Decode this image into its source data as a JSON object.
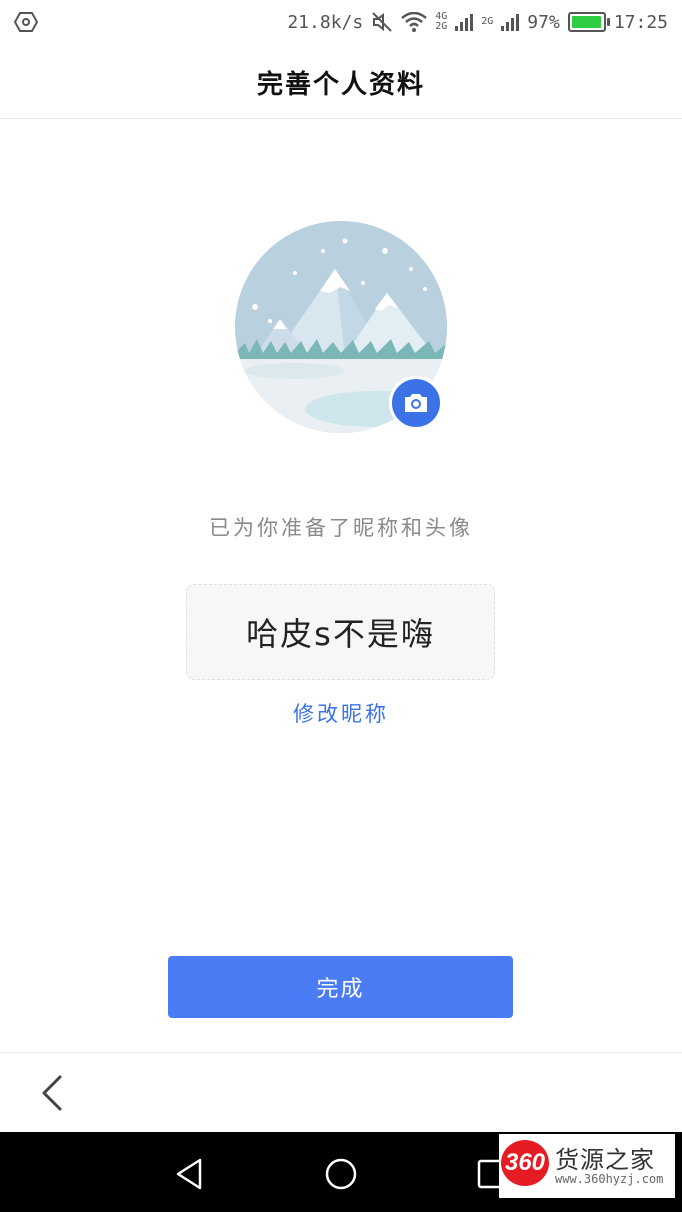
{
  "status_bar": {
    "network_speed": "21.8k/s",
    "network_4g": "4G",
    "network_2g_a": "2G",
    "network_2g_b": "2G",
    "battery_percent": "97%",
    "time": "17:25"
  },
  "header": {
    "title": "完善个人资料"
  },
  "profile": {
    "hint": "已为你准备了昵称和头像",
    "nickname": "哈皮s不是嗨",
    "edit_link": "修改昵称",
    "done_label": "完成"
  },
  "watermark": {
    "badge": "360",
    "name": "货源之家",
    "url": "www.360hyzj.com"
  },
  "colors": {
    "accent": "#3b72e8",
    "button": "#4a7cf5",
    "battery": "#2ecc40"
  },
  "icons": {
    "status_left": "hexagon-icon",
    "mute": "mute-icon",
    "wifi": "wifi-icon",
    "camera": "camera-icon",
    "back": "chevron-left-icon",
    "nav_back": "triangle-back-icon",
    "nav_home": "circle-home-icon",
    "nav_recents": "square-recents-icon"
  }
}
